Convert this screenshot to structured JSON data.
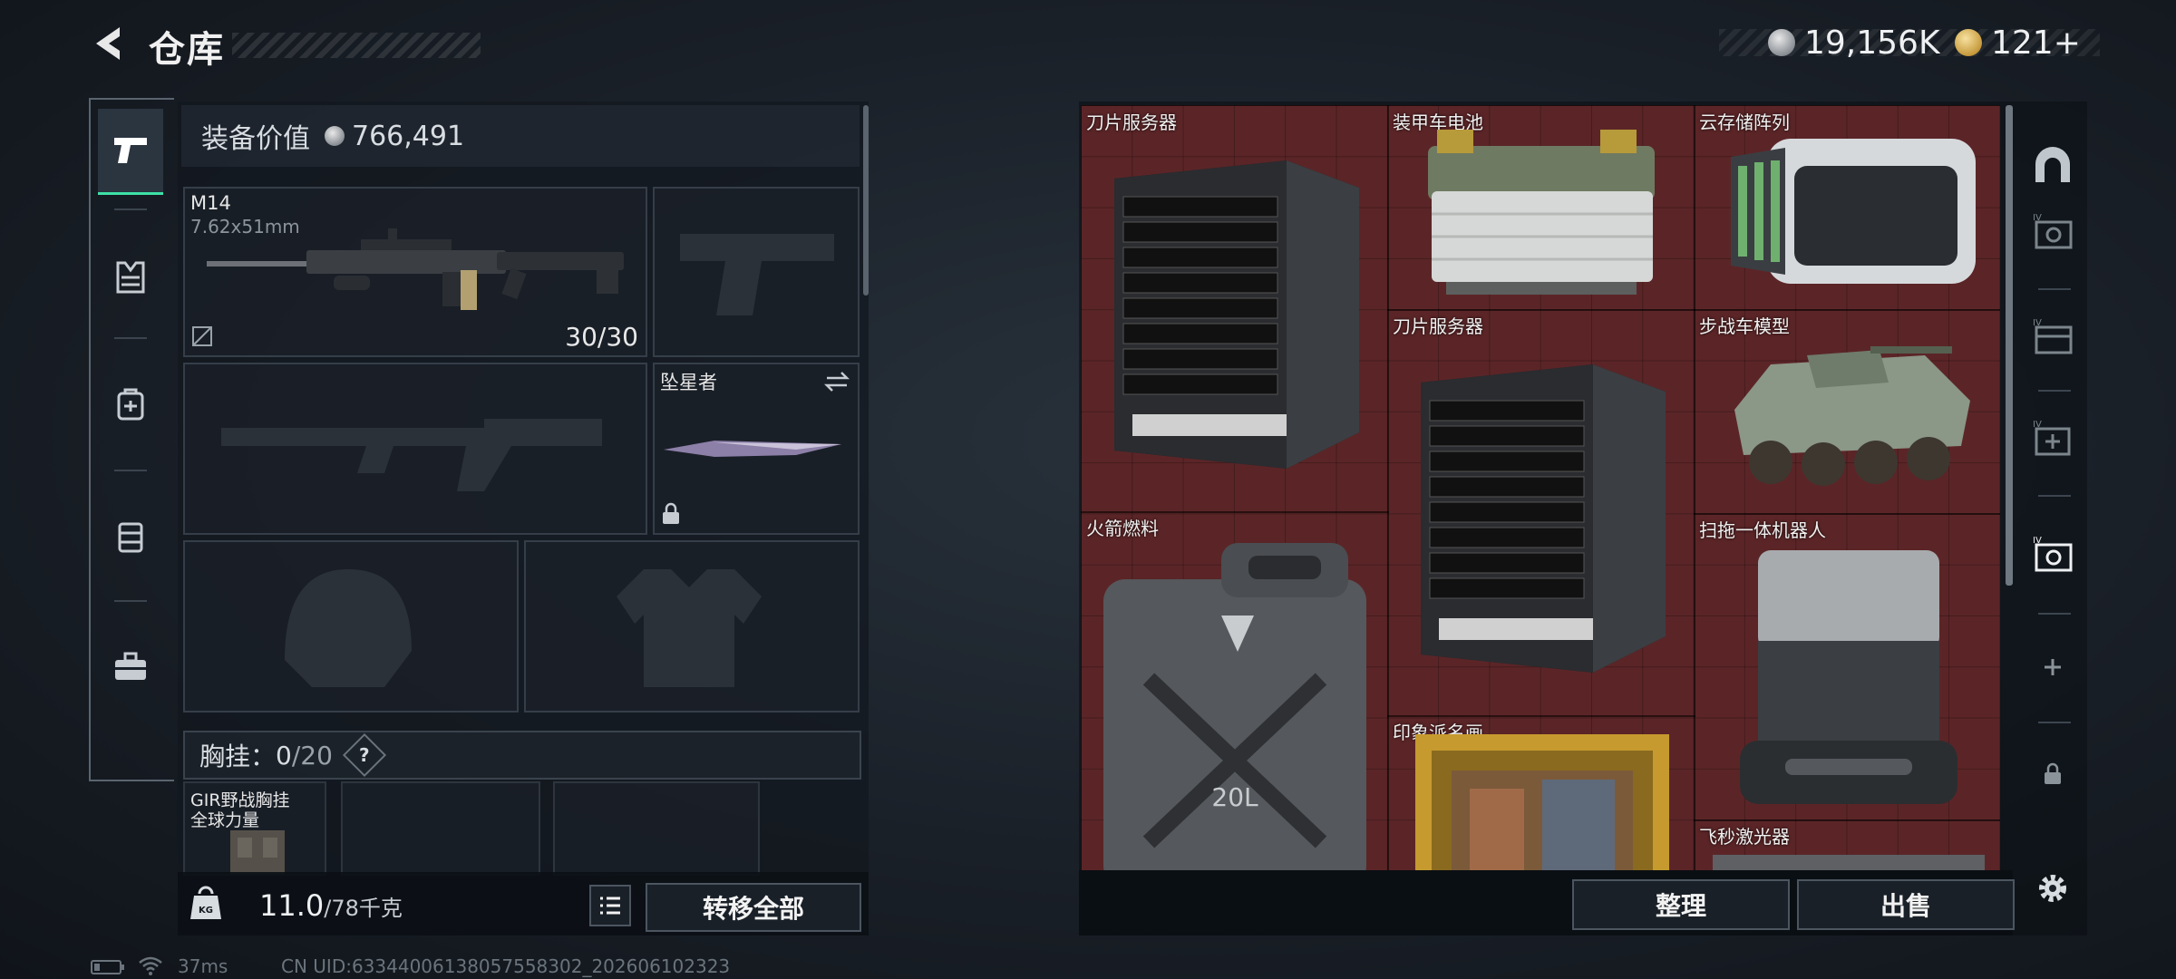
{
  "header": {
    "title": "仓库"
  },
  "currency": [
    {
      "icon": "silver-coin-icon",
      "value": "19,156K"
    },
    {
      "icon": "gold-coin-icon",
      "value": "121+"
    }
  ],
  "loadout": {
    "value_label": "装备价值",
    "value": "766,491",
    "primary": {
      "name": "M14",
      "caliber": "7.62x51mm",
      "ammo": "30/30"
    },
    "melee": {
      "name": "坠星者"
    },
    "chest": {
      "label": "胸挂：",
      "count": "0",
      "capacity": "/20",
      "help": "?"
    },
    "chest_item": {
      "name": "GIR野战胸挂",
      "sub": "全球力量"
    },
    "weight": {
      "value": "11.0",
      "max": "/78千克"
    },
    "transfer_all": "转移全部"
  },
  "stash": {
    "items": [
      {
        "name": "刀片服务器"
      },
      {
        "name": "装甲车电池"
      },
      {
        "name": "云存储阵列"
      },
      {
        "name": "刀片服务器"
      },
      {
        "name": "步战车模型"
      },
      {
        "name": "火箭燃料"
      },
      {
        "name": "扫拖一体机器人"
      },
      {
        "name": "印象派名画"
      },
      {
        "name": "飞秒激光器"
      }
    ],
    "sort_label": "整理",
    "sell_label": "出售"
  },
  "status": {
    "ping": "37ms",
    "uid": "CN UID:6334400613805755830​2_202606102323"
  },
  "colors": {
    "accent": "#3ee0a8",
    "stash_bg": "#5b2527"
  }
}
